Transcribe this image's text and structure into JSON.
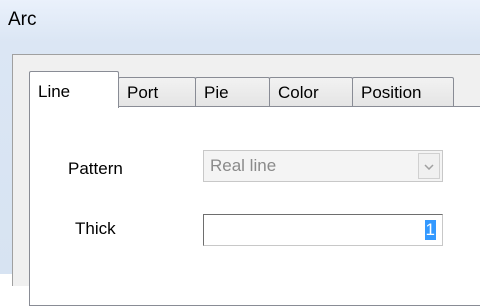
{
  "window": {
    "title": "Arc"
  },
  "tabs": [
    {
      "label": "Line",
      "active": true
    },
    {
      "label": "Port",
      "active": false
    },
    {
      "label": "Pie",
      "active": false
    },
    {
      "label": "Color",
      "active": false
    },
    {
      "label": "Position",
      "active": false
    }
  ],
  "line_tab": {
    "pattern_label": "Pattern",
    "pattern_value": "Real line",
    "pattern_enabled": false,
    "thick_label": "Thick",
    "thick_value": "1"
  },
  "colors": {
    "titlebar": "#dbe6f4",
    "dialog_bg": "#f0f0f0",
    "selection": "#3399ff"
  }
}
